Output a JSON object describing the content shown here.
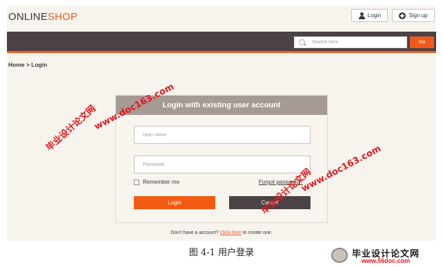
{
  "brand": {
    "part1": "ONLINE",
    "part2": "SHOP"
  },
  "header": {
    "login_label": "Login",
    "signup_label": "Sign up"
  },
  "search": {
    "placeholder": "Search here",
    "go_label": "Go"
  },
  "breadcrumb": "Home > Login",
  "login_panel": {
    "title": "Login with existing user account",
    "username_placeholder": "User name",
    "password_placeholder": "Password",
    "remember_label": "Remember me",
    "forgot_label": "Forgot password?",
    "submit_label": "Login",
    "cancel_label": "Cancel"
  },
  "signup_prompt": {
    "text_before": "Don't have a account?",
    "link_text": "Click here",
    "text_after": "to create one."
  },
  "caption": "图 4-1   用户登录",
  "watermarks": {
    "cn": "毕业设计论文网",
    "url": "www.doc163.com"
  },
  "corner_logo": {
    "title": "毕业设计论文网",
    "url": "www.56doc.com"
  },
  "colors": {
    "accent": "#ef5a1a",
    "nav": "#4a4244",
    "panel_header": "#a69a94",
    "watermark": "#e8161e"
  }
}
